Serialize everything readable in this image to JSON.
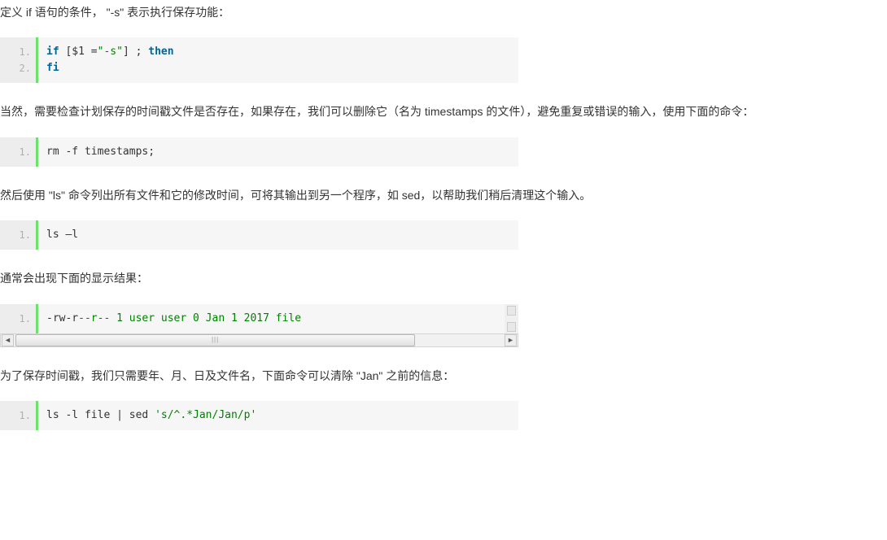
{
  "paragraphs": {
    "p1": "定义 if 语句的条件， \"-s\" 表示执行保存功能：",
    "p2": "当然，需要检查计划保存的时间戳文件是否存在，如果存在，我们可以删除它（名为 timestamps 的文件），避免重复或错误的输入，使用下面的命令：",
    "p3": "然后使用 \"ls\" 命令列出所有文件和它的修改时间，可将其输出到另一个程序，如 sed，以帮助我们稍后清理这个输入。",
    "p4": "通常会出现下面的显示结果：",
    "p5": "为了保存时间戳，我们只需要年、月、日及文件名，下面命令可以清除 \"Jan\" 之前的信息："
  },
  "code1": {
    "lines": [
      "1.",
      "2."
    ],
    "l1_if": "if",
    "l1_bracket": " [$1 =",
    "l1_str": "\"-s\"",
    "l1_bracket2": "] ; ",
    "l1_then": "then",
    "l2": "fi"
  },
  "code2": {
    "lines": [
      "1."
    ],
    "l1": "rm -f timestamps;"
  },
  "code3": {
    "lines": [
      "1."
    ],
    "l1": "ls –l"
  },
  "code4": {
    "lines": [
      "1."
    ],
    "l1_prefix": "-rw-r",
    "l1_mid": "--r-- 1 user user 0 Jan 1 2017 file"
  },
  "code5": {
    "lines": [
      "1."
    ],
    "l1_cmd": "ls -l file | sed ",
    "l1_str": "'s/^.*Jan/Jan/p'"
  }
}
